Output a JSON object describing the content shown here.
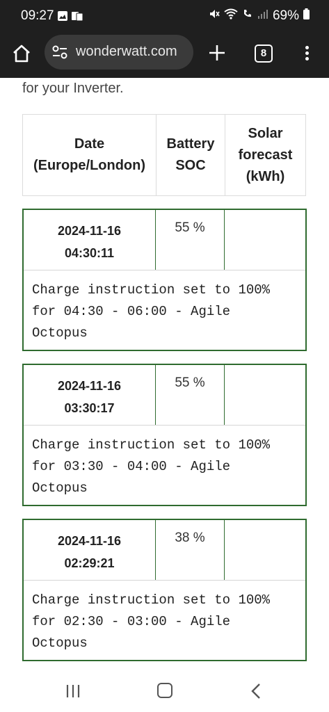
{
  "status_bar": {
    "time": "09:27",
    "battery": "69%",
    "left_icons": [
      "image-icon",
      "notification-icon"
    ],
    "right_icons": [
      "mute-icon",
      "wifi-icon",
      "wifi-call-icon",
      "signal-icon",
      "battery-icon"
    ]
  },
  "browser": {
    "url": "wonderwatt.com",
    "tab_count": "8"
  },
  "page": {
    "intro_text": "for your Inverter.",
    "table_headers": {
      "date_line1": "Date",
      "date_line2": "(Europe/London)",
      "battery_line1": "Battery",
      "battery_line2": "SOC",
      "solar_line1": "Solar",
      "solar_line2": "forecast",
      "solar_line3": "(kWh)"
    },
    "entries": [
      {
        "date": "2024-11-16",
        "time": "04:30:11",
        "soc": "55 %",
        "solar": "",
        "message": "Charge instruction set to 100%\nfor 04:30 - 06:00 - Agile\nOctopus"
      },
      {
        "date": "2024-11-16",
        "time": "03:30:17",
        "soc": "55 %",
        "solar": "",
        "message": "Charge instruction set to 100%\nfor 03:30 - 04:00 - Agile\nOctopus"
      },
      {
        "date": "2024-11-16",
        "time": "02:29:21",
        "soc": "38 %",
        "solar": "",
        "message": "Charge instruction set to 100%\nfor 02:30 - 03:00 - Agile\nOctopus"
      }
    ]
  },
  "colors": {
    "top_bar": "#1f1f1f",
    "entry_border": "#2f6b2f"
  }
}
